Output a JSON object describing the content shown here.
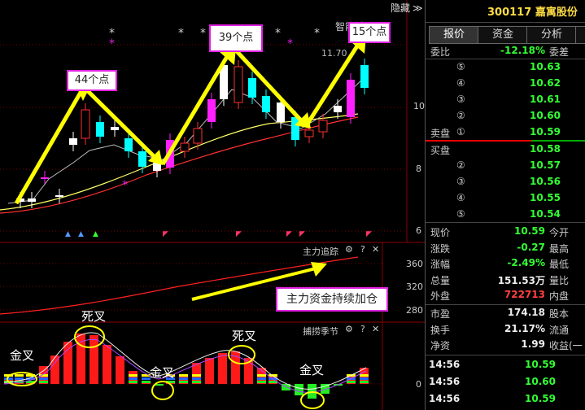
{
  "header": {
    "hide_label": "隐藏",
    "hide_arrows": "≫",
    "code": "300117",
    "name": "嘉寓股份"
  },
  "tabs": [
    "报价",
    "资金",
    "分析"
  ],
  "main_chart": {
    "indicator_label": "智能辅助",
    "price_label": "11.70",
    "y_ticks": [
      "10",
      "8",
      "6"
    ],
    "annotations": [
      "44个点",
      "39个点",
      "15个点"
    ],
    "stars": [
      "*",
      "*",
      "*",
      "*",
      "*",
      "*",
      "*",
      "*"
    ]
  },
  "panel2": {
    "title": "主力追踪",
    "gear": "⚙",
    "help": "?",
    "close": "✕",
    "y_ticks": [
      "360",
      "320",
      "280"
    ],
    "annotation": "主力资金持续加仓"
  },
  "panel3": {
    "title": "捕捞季节",
    "gear": "⚙",
    "help": "?",
    "close": "✕",
    "y_ticks": [
      "0"
    ],
    "labels": [
      "金叉",
      "死叉",
      "金叉",
      "死叉",
      "金叉"
    ]
  },
  "order_book": {
    "weibi_label": "委比",
    "weibi_value": "-12.18%",
    "weicha_label": "委差",
    "sell_label": "卖盘",
    "buy_label": "买盘",
    "sell": [
      {
        "level": "⑤",
        "price": "10.63"
      },
      {
        "level": "④",
        "price": "10.62"
      },
      {
        "level": "③",
        "price": "10.61"
      },
      {
        "level": "②",
        "price": "10.60"
      },
      {
        "level": "①",
        "price": "10.59"
      }
    ],
    "buy": [
      {
        "level": "①",
        "price": "10.58"
      },
      {
        "level": "②",
        "price": "10.57"
      },
      {
        "level": "③",
        "price": "10.56"
      },
      {
        "level": "④",
        "price": "10.55"
      },
      {
        "level": "⑤",
        "price": "10.54"
      }
    ]
  },
  "quote": [
    {
      "l": "现价",
      "v": "10.59",
      "c": "green",
      "r": "今开"
    },
    {
      "l": "涨跌",
      "v": "-0.27",
      "c": "green",
      "r": "最高"
    },
    {
      "l": "涨幅",
      "v": "-2.49%",
      "c": "green",
      "r": "最低"
    },
    {
      "l": "总量",
      "v": "151.53万",
      "c": "white",
      "r": "量比"
    },
    {
      "l": "外盘",
      "v": "722713",
      "c": "red",
      "r": "内盘"
    }
  ],
  "quote2": [
    {
      "l": "市盈",
      "v": "174.18",
      "r": "股本"
    },
    {
      "l": "换手",
      "v": "21.17%",
      "r": "流通"
    },
    {
      "l": "净资",
      "v": "1.99",
      "r": "收益(一"
    }
  ],
  "ticks": [
    {
      "t": "14:56",
      "p": "10.59"
    },
    {
      "t": "14:56",
      "p": "10.60"
    },
    {
      "t": "14:56",
      "p": "10.59"
    }
  ]
}
